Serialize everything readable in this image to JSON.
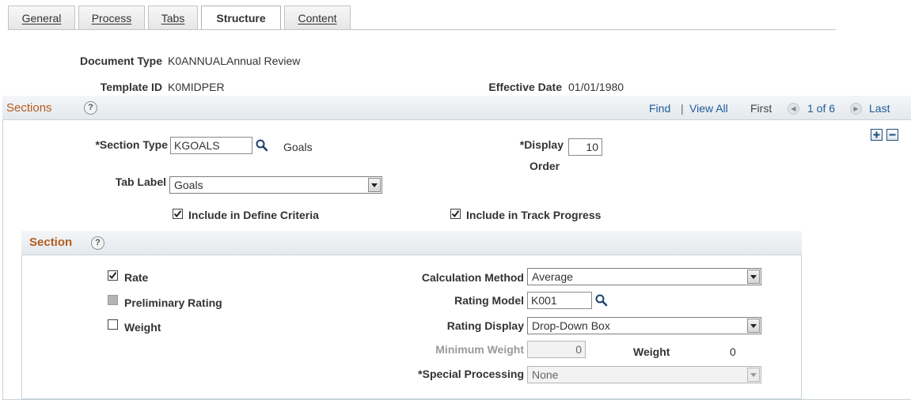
{
  "tabs": [
    {
      "label": "General"
    },
    {
      "label": "Process"
    },
    {
      "label": "Tabs"
    },
    {
      "label": "Structure"
    },
    {
      "label": "Content"
    }
  ],
  "header": {
    "document_type_label": "Document Type",
    "document_type_value": "K0ANNUAL",
    "document_type_desc": "Annual Review",
    "template_id_label": "Template ID",
    "template_id_value": "K0MIDPER",
    "effective_date_label": "Effective Date",
    "effective_date_value": "01/01/1980"
  },
  "sections": {
    "title": "Sections",
    "help": "?",
    "find": "Find",
    "separator": "|",
    "view_all": "View All",
    "first": "First",
    "count": "1 of 6",
    "last": "Last",
    "section_type_label": "*Section Type",
    "section_type_value": "KGOALS",
    "section_type_desc": "Goals",
    "display_order_label_1": "*Display",
    "display_order_label_2": "Order",
    "display_order_value": "10",
    "tab_label_label": "Tab Label",
    "tab_label_value": "Goals",
    "include_define_label": "Include in Define Criteria",
    "include_define_checked": true,
    "include_track_label": "Include in Track Progress",
    "include_track_checked": true
  },
  "section": {
    "title": "Section",
    "help": "?",
    "rate_label": "Rate",
    "rate_checked": true,
    "preliminary_label": "Preliminary Rating",
    "preliminary_checked": true,
    "preliminary_disabled": true,
    "weight_label": "Weight",
    "weight_checked": false,
    "calc_method_label": "Calculation Method",
    "calc_method_value": "Average",
    "rating_model_label": "Rating Model",
    "rating_model_value": "K001",
    "rating_display_label": "Rating Display",
    "rating_display_value": "Drop-Down Box",
    "min_weight_label": "Minimum Weight",
    "min_weight_value": "0",
    "weight_total_label": "Weight",
    "weight_total_value": "0",
    "special_processing_label": "*Special Processing",
    "special_processing_value": "None"
  },
  "icons": {
    "lookup": "magnifier-icon",
    "help": "help-icon",
    "prev": "previous-arrow-icon",
    "next": "next-arrow-icon",
    "add": "plus-icon",
    "remove": "minus-icon"
  },
  "colors": {
    "section_title": "#b35c1e",
    "link": "#1f5a9b",
    "border": "#c9d3da"
  }
}
